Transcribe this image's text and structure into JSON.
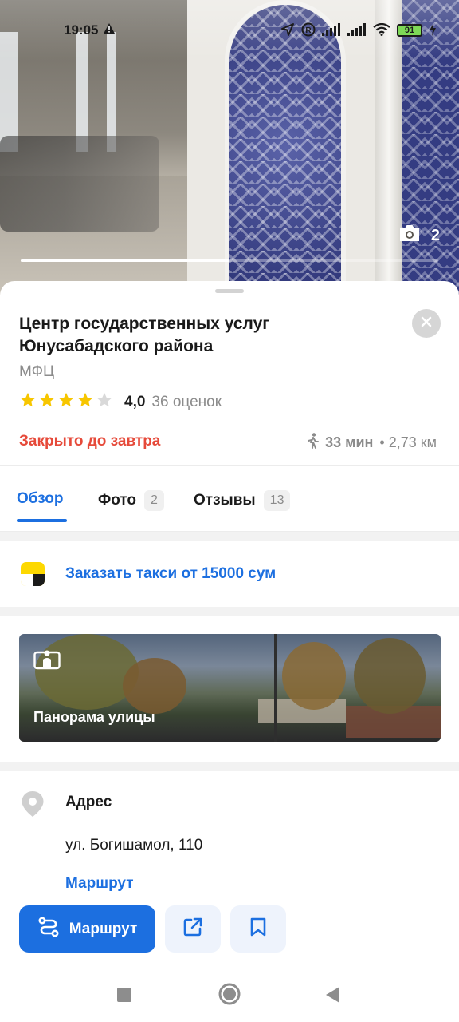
{
  "status_bar": {
    "time": "19:05",
    "battery": "91"
  },
  "photo": {
    "count": "2",
    "progress": 0.5
  },
  "place": {
    "title": "Центр государственных услуг Юнусабадского района",
    "category": "МФЦ",
    "rating_value": "4,0",
    "rating_stars": 4,
    "rating_count": "36 оценок",
    "hours_status": "Закрыто до завтра",
    "walk_time": "33 мин",
    "distance": "• 2,73 км"
  },
  "tabs": [
    {
      "label": "Обзор",
      "badge": ""
    },
    {
      "label": "Фото",
      "badge": "2"
    },
    {
      "label": "Отзывы",
      "badge": "13"
    }
  ],
  "taxi": {
    "label": "Заказать такси от 15000 сум"
  },
  "panorama": {
    "label": "Панорама улицы"
  },
  "address": {
    "heading": "Адрес",
    "value": "ул. Богишамол, 110",
    "route_link": "Маршрут"
  },
  "actions": {
    "route_label": "Маршрут"
  },
  "colors": {
    "accent": "#1c6fe0",
    "closed": "#e64a3a",
    "star": "#f7c600"
  }
}
